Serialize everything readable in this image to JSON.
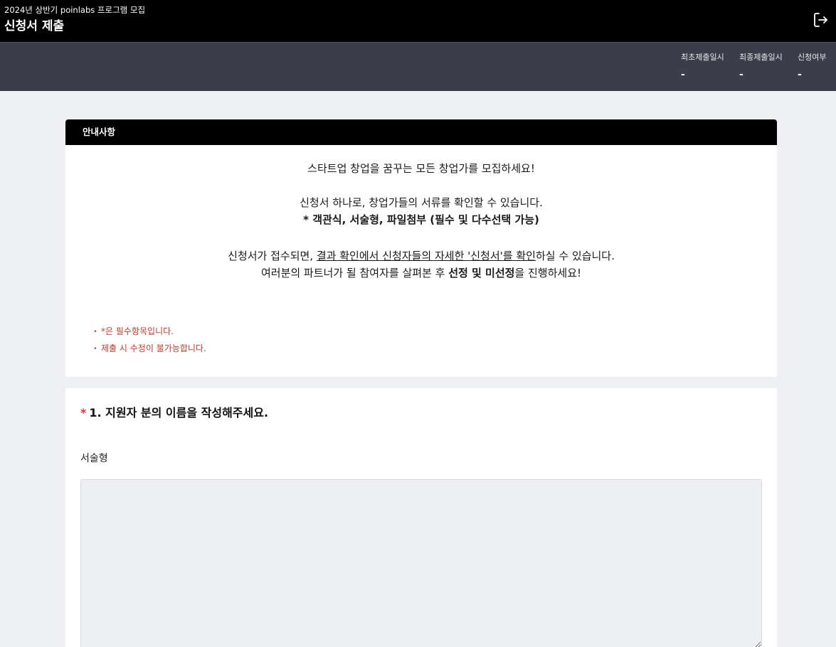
{
  "header": {
    "subtitle": "2024년 상반기 poinlabs 프로그램 모집",
    "title": "신청서 제출",
    "logout_icon": "logout-icon"
  },
  "status": [
    {
      "label": "최초제출일시",
      "value": "-"
    },
    {
      "label": "최종제출일시",
      "value": "-"
    },
    {
      "label": "신청여부",
      "value": "-"
    }
  ],
  "notice": {
    "heading": "안내사항",
    "line1": "스타트업 창업을 꿈꾸는 모든 창업가를 모집하세요!",
    "line2": "신청서 하나로, 창업가들의 서류를 확인할 수 있습니다.",
    "line3": "* 객관식, 서술형, 파일첨부 (필수 및 다수선택 가능)",
    "line4_pre": "신청서가 접수되면, ",
    "line4_link": "결과 확인에서 신청자들의 자세한 '신청서'를 확인",
    "line4_post": "하실 수 있습니다.",
    "line5_pre": "여러분의 파트너가 될 참여자를 살펴본 후 ",
    "line5_bold": "선정 및 미선정",
    "line5_post": "을 진행하세요!",
    "notes": [
      "*은 필수항목입니다.",
      "제출 시 수정이 불가능합니다."
    ]
  },
  "question": {
    "required_mark": "*",
    "title": "1. 지원자 분의 이름을 작성해주세요.",
    "type": "서술형",
    "answer": ""
  },
  "colors": {
    "topbar": "#000000",
    "statusbar": "#3b3e4a",
    "background": "#eff0f3",
    "required": "#d63b2f"
  }
}
